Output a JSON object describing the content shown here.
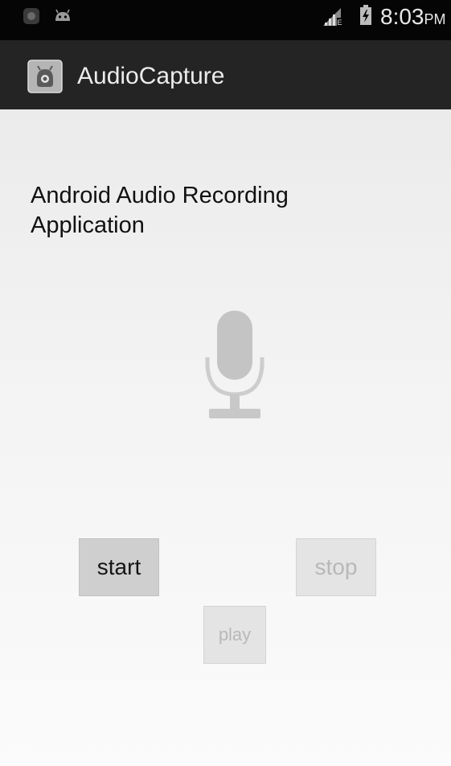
{
  "status_bar": {
    "time": "8:03",
    "ampm": "PM",
    "icons": [
      "app-notification-icon",
      "android-notification-icon",
      "signal-icon",
      "battery-icon"
    ]
  },
  "action_bar": {
    "icon": "app-icon",
    "title": "AudioCapture"
  },
  "main": {
    "heading": "Android Audio Recording Application",
    "illustration": "microphone-icon",
    "buttons": {
      "start": "start",
      "stop": "stop",
      "play": "play"
    }
  },
  "colors": {
    "status_bar_bg": "#050505",
    "action_bar_bg": "#242424",
    "content_bg": "#f2f2f2",
    "button_bg": "#d6d6d6",
    "button_disabled_text": "#b8b8b8"
  }
}
